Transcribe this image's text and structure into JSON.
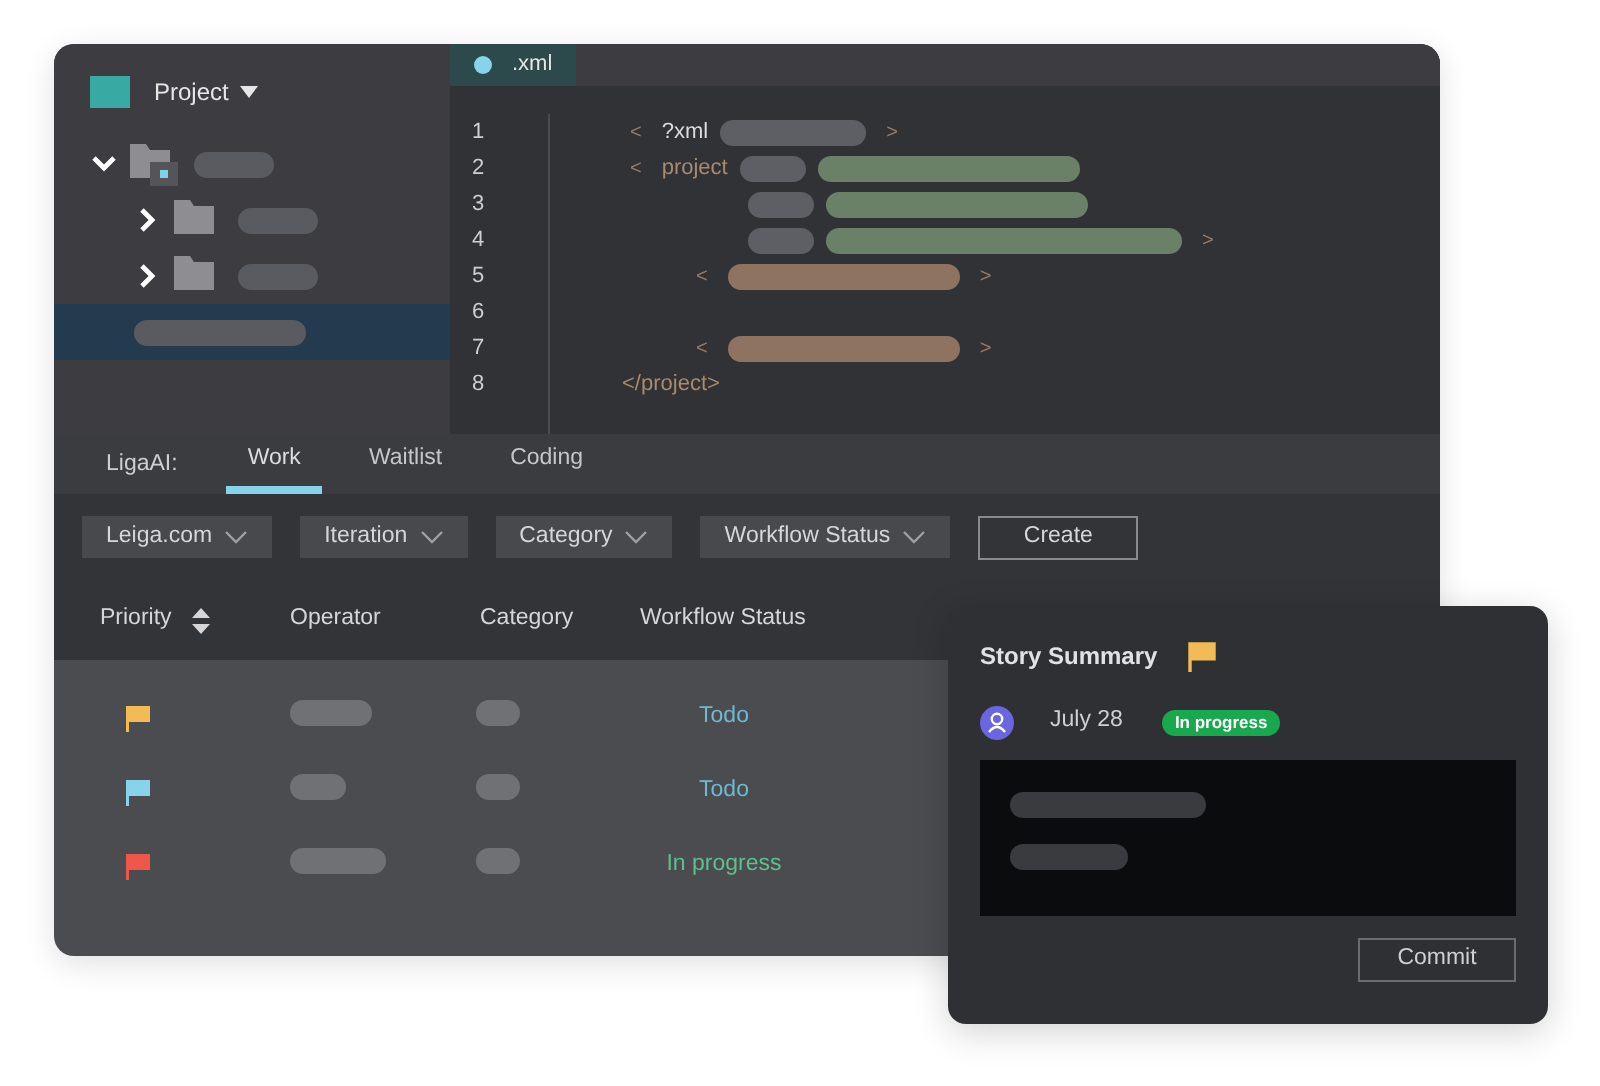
{
  "sidebar": {
    "project_label": "Project",
    "tree": [
      {
        "kind": "folder",
        "expanded": true,
        "selected": false,
        "children": [
          {
            "kind": "folder",
            "expanded": false,
            "selected": false
          },
          {
            "kind": "folder",
            "expanded": false,
            "selected": false
          },
          {
            "kind": "file",
            "selected": true
          }
        ]
      }
    ]
  },
  "editor": {
    "tab": ".xml",
    "line_numbers": [
      "1",
      "2",
      "3",
      "4",
      "5",
      "6",
      "7",
      "8"
    ],
    "lines": [
      {
        "kind": "code",
        "tokens": [
          {
            "kind": "punct",
            "text": "<"
          },
          {
            "kind": "keyword",
            "text": "?xml"
          },
          {
            "kind": "name"
          },
          {
            "kind": "punct",
            "text": ">"
          }
        ]
      },
      {
        "kind": "code",
        "tokens": [
          {
            "kind": "punct",
            "text": "<"
          },
          {
            "kind": "tag",
            "text": "project"
          },
          {
            "kind": "name"
          },
          {
            "kind": "value"
          }
        ]
      },
      {
        "kind": "code",
        "tokens": [
          {
            "kind": "name"
          },
          {
            "kind": "value"
          }
        ]
      },
      {
        "kind": "code",
        "tokens": [
          {
            "kind": "name"
          },
          {
            "kind": "value"
          },
          {
            "kind": "punct",
            "text": ">"
          }
        ]
      },
      {
        "kind": "code",
        "tokens": [
          {
            "kind": "punct",
            "text": "<"
          },
          {
            "kind": "content"
          },
          {
            "kind": "punct",
            "text": ">"
          }
        ]
      },
      {
        "kind": "blank"
      },
      {
        "kind": "code",
        "tokens": [
          {
            "kind": "punct",
            "text": "<"
          },
          {
            "kind": "content"
          },
          {
            "kind": "punct",
            "text": ">"
          }
        ]
      },
      {
        "kind": "code",
        "tokens": [
          {
            "kind": "tag",
            "text": "</project>"
          }
        ]
      }
    ]
  },
  "panel": {
    "label": "LigaAI:",
    "tabs": [
      {
        "label": "Work",
        "selected": true
      },
      {
        "label": "Waitlist",
        "selected": false
      },
      {
        "label": "Coding",
        "selected": false
      }
    ],
    "filters": [
      "Leiga.com",
      "Iteration",
      "Category",
      "Workflow Status"
    ],
    "create_button": "Create",
    "columns": [
      {
        "label": "Priority",
        "sortable": true
      },
      {
        "label": "Operator",
        "sortable": false
      },
      {
        "label": "Category",
        "sortable": false
      },
      {
        "label": "Workflow Status",
        "sortable": false
      }
    ],
    "rows": [
      {
        "flag": {
          "color": "#f2bb55"
        },
        "status": {
          "text": "Todo",
          "color": "#6fb9d0"
        }
      },
      {
        "flag": {
          "color": "#86d3ea"
        },
        "status": {
          "text": "Todo",
          "color": "#6fb9d0"
        }
      },
      {
        "flag": {
          "color": "#f0574b"
        },
        "status": {
          "text": "In progress",
          "color": "#5fbf8a"
        }
      }
    ]
  },
  "card": {
    "title": "Story Summary",
    "flag": {
      "color": "#f2bb55"
    },
    "date": "July 28",
    "badge": "In progress",
    "button": "Commit"
  }
}
